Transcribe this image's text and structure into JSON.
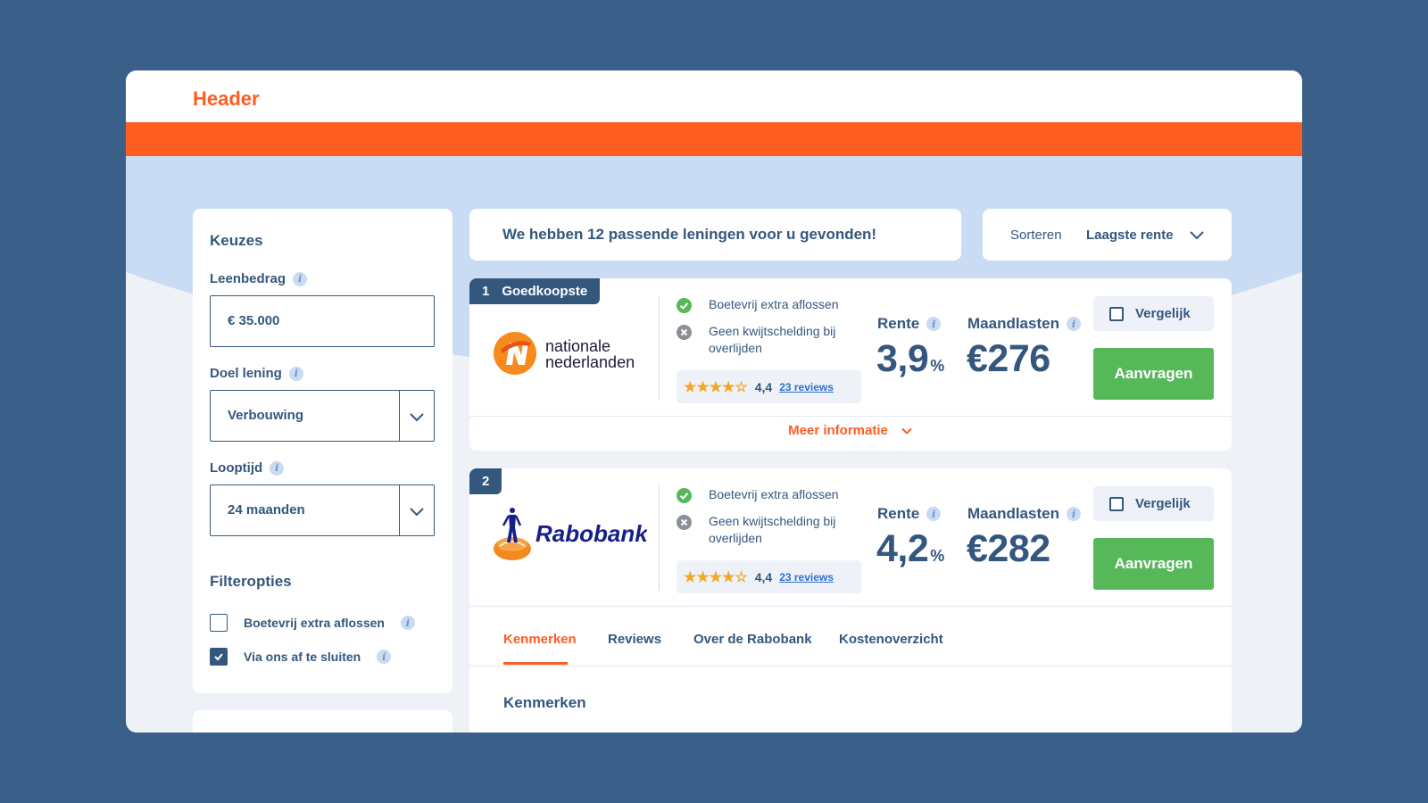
{
  "header": {
    "title": "Header"
  },
  "colors": {
    "brand_orange": "#ff5c22",
    "navy": "#34577e",
    "green": "#57b85a",
    "page_bg": "#3a5f88",
    "hero_blue": "#cadcf4"
  },
  "sidebar": {
    "title": "Keuzes",
    "fields": [
      {
        "label": "Leenbedrag",
        "value": "€ 35.000"
      },
      {
        "label": "Doel lening",
        "value": "Verbouwing"
      },
      {
        "label": "Looptijd",
        "value": "24 maanden"
      }
    ],
    "filters_title": "Filteropties",
    "filters": [
      {
        "label": "Boetevrij extra aflossen",
        "checked": false
      },
      {
        "label": "Via ons af te sluiten",
        "checked": true
      }
    ]
  },
  "results": {
    "banner": "We hebben 12 passende leningen voor u gevonden!"
  },
  "sort": {
    "label": "Sorteren",
    "value": "Laagste rente"
  },
  "offers": [
    {
      "rank": "1",
      "badge": "Goedkoopste",
      "logo_line1": "nationale",
      "logo_line2": "nederlanden",
      "feature_yes": "Boetevrij extra aflossen",
      "feature_no_1": "Geen kwijtschelding bij",
      "feature_no_2": "overlijden",
      "rating": "4,4",
      "rating_stars": 4,
      "reviews": "23 reviews",
      "rente_label": "Rente",
      "rente_value": "3,9",
      "rente_unit": "%",
      "maand_label": "Maandlasten",
      "maand_value": "€276",
      "compare": "Vergelijk",
      "apply": "Aanvragen",
      "more": "Meer informatie"
    },
    {
      "rank": "2",
      "logo_text": "Rabobank",
      "feature_yes": "Boetevrij extra aflossen",
      "feature_no_1": "Geen kwijtschelding bij",
      "feature_no_2": "overlijden",
      "rating": "4,4",
      "rating_stars": 4,
      "reviews": "23 reviews",
      "rente_label": "Rente",
      "rente_value": "4,2",
      "rente_unit": "%",
      "maand_label": "Maandlasten",
      "maand_value": "€282",
      "compare": "Vergelijk",
      "apply": "Aanvragen",
      "tabs": [
        "Kenmerken",
        "Reviews",
        "Over de Rabobank",
        "Kostenoverzicht"
      ],
      "section_title": "Kenmerken"
    }
  ],
  "icons": {
    "info": "info-icon",
    "chevron": "chevron-down-icon",
    "check": "check-circle-icon",
    "cross": "x-circle-icon",
    "star": "star-icon"
  }
}
